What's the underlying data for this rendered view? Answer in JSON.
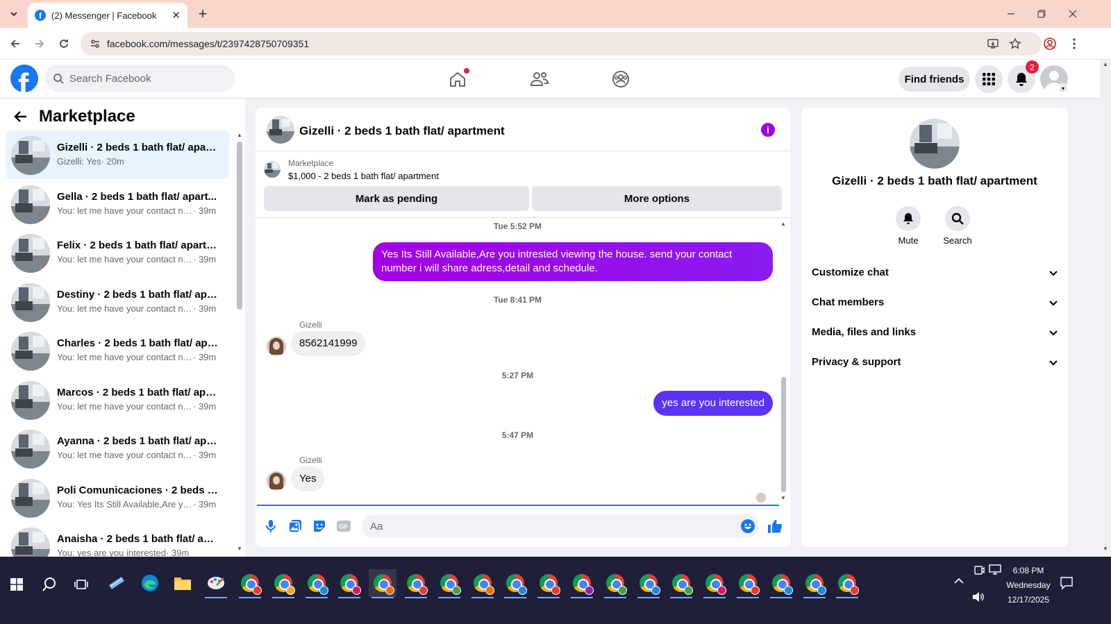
{
  "browser": {
    "tab_title": "(2) Messenger | Facebook",
    "url": "facebook.com/messages/t/2397428750709351"
  },
  "header": {
    "search_placeholder": "Search Facebook",
    "find_friends": "Find friends",
    "notification_count": "2"
  },
  "sidebar": {
    "title": "Marketplace",
    "conversations": [
      {
        "name": "Gizelli · 2 beds 1 bath flat/ apart...",
        "preview": "Gizelli: Yes",
        "time": "· 20m",
        "active": true
      },
      {
        "name": "Gella · 2 beds 1 bath flat/ apart...",
        "preview": "You: let me have your contact nu...",
        "time": "· 39m"
      },
      {
        "name": "Felix · 2 beds 1 bath flat/ apartm...",
        "preview": "You: let me have your contact nu...",
        "time": "· 39m"
      },
      {
        "name": "Destiny · 2 beds 1 bath flat/ apar...",
        "preview": "You: let me have your contact nu...",
        "time": "· 39m"
      },
      {
        "name": "Charles · 2 beds 1 bath flat/ apar...",
        "preview": "You: let me have your contact nu...",
        "time": "· 39m"
      },
      {
        "name": "Marcos · 2 beds 1 bath flat/ apar...",
        "preview": "You: let me have your contact nu...",
        "time": "· 39m"
      },
      {
        "name": "Ayanna · 2 beds 1 bath flat/ apar...",
        "preview": "You: let me have your contact nu...",
        "time": "· 39m"
      },
      {
        "name": "Poli Comunicaciones · 2 beds 1 b...",
        "preview": "You: Yes Its Still Available,Are you ...",
        "time": "· 39m"
      },
      {
        "name": "Anaisha · 2 beds 1 bath flat/ apa...",
        "preview": "You: yes are you interested",
        "time": "· 39m"
      }
    ]
  },
  "chat": {
    "title": "Gizelli · 2 beds 1 bath flat/ apartment",
    "marketplace_label": "Marketplace",
    "listing": "$1,000 - 2 beds 1 bath flat/ apartment",
    "mark_pending": "Mark as pending",
    "more_options": "More options",
    "messages": {
      "ts1": "Tue 5:52 PM",
      "m1": "Yes Its Still Available,Are you intrested viewing the house. send your contact number i will share adress,detail and schedule.",
      "ts2": "Tue 8:41 PM",
      "sender1": "Gizelli",
      "m2": "8562141999",
      "ts3": "5:27 PM",
      "m3": "yes are you interested",
      "ts4": "5:47 PM",
      "sender2": "Gizelli",
      "m4": "Yes"
    },
    "input_placeholder": "Aa",
    "gif_label": "GIF"
  },
  "details": {
    "name": "Gizelli · 2 beds 1 bath flat/ apartment",
    "mute": "Mute",
    "search": "Search",
    "sections": [
      "Customize chat",
      "Chat members",
      "Media, files and links",
      "Privacy & support"
    ]
  },
  "taskbar": {
    "time": "6:08 PM",
    "day": "Wednesday",
    "date": "12/17/2025"
  },
  "colors": {
    "fb_blue": "#1877f2",
    "bubble_purple": "#a300e5",
    "bubble_indigo": "#5c33f6"
  }
}
